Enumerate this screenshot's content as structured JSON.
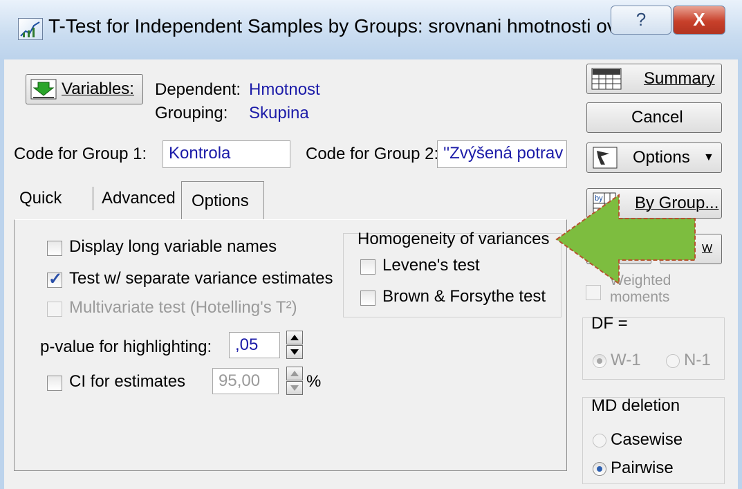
{
  "window": {
    "title": "T-Test for Independent Samples by Groups: srovnani hmotnosti ovci",
    "help_glyph": "?",
    "close_glyph": "X"
  },
  "variables": {
    "button_label": "Variables:",
    "dependent_label": "Dependent:",
    "dependent_value": "Hmotnost",
    "grouping_label": "Grouping:",
    "grouping_value": "Skupina"
  },
  "codes": {
    "group1_label": "Code for Group 1:",
    "group1_value": "Kontrola",
    "group2_label": "Code for Group 2:",
    "group2_value": "''Zvýšená potrav"
  },
  "tabs": [
    {
      "label": "Quick",
      "active": false
    },
    {
      "label": "Advanced",
      "active": false
    },
    {
      "label": "Options",
      "active": true
    }
  ],
  "options": {
    "display_long_names": {
      "label": "Display long variable names",
      "checked": false
    },
    "separate_variance": {
      "label": "Test w/ separate variance estimates",
      "checked": true
    },
    "multivariate": {
      "label": "Multivariate test (Hotelling's T²)",
      "checked": false,
      "enabled": false
    },
    "p_value_label": "p-value for highlighting:",
    "p_value": ",05",
    "ci_label": "CI for estimates",
    "ci_checked": false,
    "ci_value": "95,00",
    "ci_unit": "%"
  },
  "homogeneity": {
    "title": "Homogeneity of variances",
    "levene": {
      "label": "Levene's test",
      "checked": false
    },
    "brown_forsythe": {
      "label": "Brown & Forsythe test",
      "checked": false
    }
  },
  "right_panel": {
    "summary_label": "Summary",
    "cancel_label": "Cancel",
    "options_label": "Options",
    "by_group_label": "By Group...",
    "w_label": "W",
    "weighted_label_line1": "Weighted",
    "weighted_label_line2": "moments",
    "df_title": "DF =",
    "df_w1": "W-1",
    "df_n1": "N-1",
    "md_title": "MD deletion",
    "md_casewise": "Casewise",
    "md_pairwise": "Pairwise"
  },
  "colors": {
    "accent_text": "#1b1ba8",
    "arrow_fill": "#7dbd3f",
    "arrow_outline": "#b5542f",
    "check_mark": "#2a4fa8"
  }
}
